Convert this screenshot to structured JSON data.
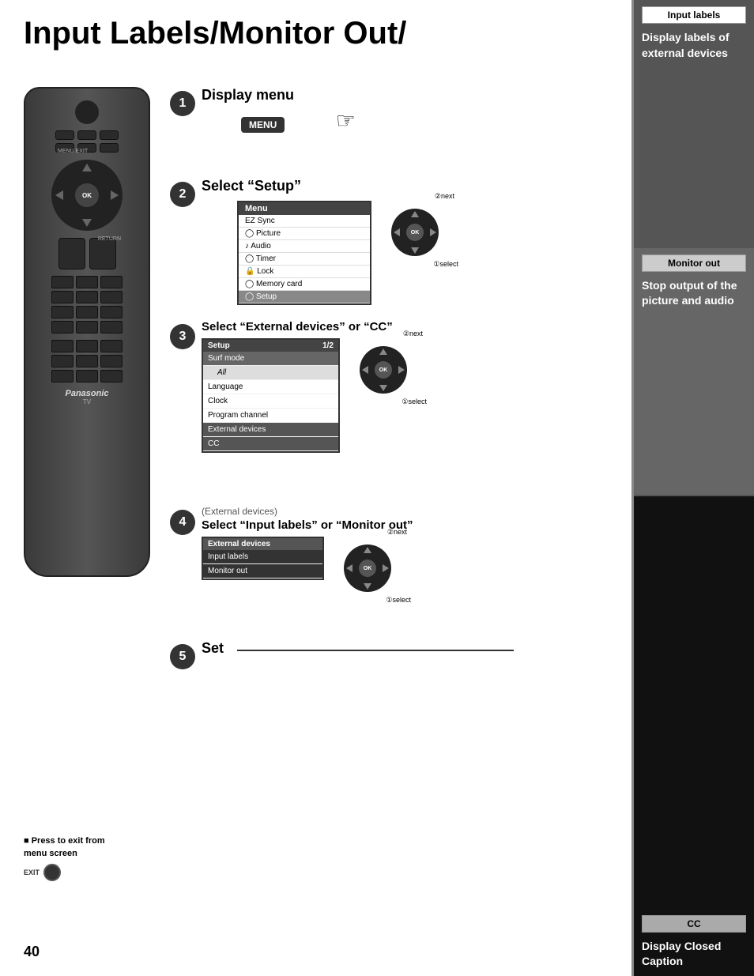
{
  "page": {
    "title": "Input Labels/Monitor Out/",
    "number": "40"
  },
  "steps": {
    "step1": {
      "number": "1",
      "title": "Display menu",
      "button_label": "MENU"
    },
    "step2": {
      "number": "2",
      "title": "Select “Setup”",
      "menu_header": "Menu",
      "menu_items": [
        "EZ Sync",
        "Picture",
        "Audio",
        "Timer",
        "Lock",
        "Memory card",
        "Setup"
      ]
    },
    "step3": {
      "number": "3",
      "title": "Select “External devices” or “CC”",
      "menu_header": "Setup",
      "menu_page": "1/2",
      "menu_items": [
        "Surf mode",
        "All",
        "Language",
        "Clock",
        "Program channel",
        "External devices",
        "CC"
      ]
    },
    "step4": {
      "number": "4",
      "subtitle": "(External devices)",
      "title": "Select “Input labels” or “Monitor out”",
      "menu_header": "External devices",
      "menu_items": [
        "Input labels",
        "Monitor out"
      ]
    },
    "step5": {
      "number": "5",
      "label": "Set"
    }
  },
  "nav_labels": {
    "next": "②next",
    "select": "①select"
  },
  "press_exit": {
    "symbol": "EXIT",
    "text_line1": "■ Press to exit from",
    "text_line2": "menu screen"
  },
  "sidebar": {
    "sections": [
      {
        "tab": "Input labels",
        "description": "Display labels of external devices"
      },
      {
        "tab": "Monitor out",
        "description": "Stop output of the picture and audio"
      },
      {
        "tab": "CC",
        "description": "Display Closed Caption"
      }
    ]
  },
  "remote": {
    "brand": "Panasonic",
    "tv_label": "TV"
  }
}
